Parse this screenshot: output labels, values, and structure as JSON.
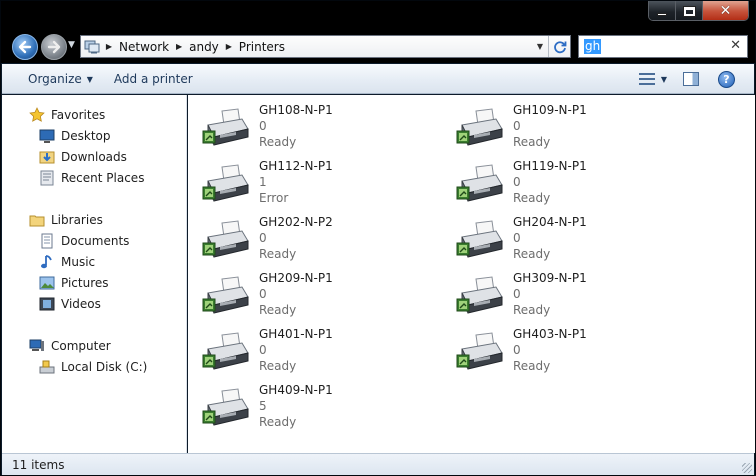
{
  "window": {
    "caption": {
      "minimize_icon": "minimize-icon",
      "maximize_icon": "maximize-icon",
      "close_icon": "close-icon",
      "close_glyph": "✕"
    }
  },
  "navigation": {
    "back_icon": "arrow-left-icon",
    "forward_icon": "arrow-right-icon",
    "breadcrumbs": [
      {
        "label": "Network"
      },
      {
        "label": "andy"
      },
      {
        "label": "Printers"
      }
    ]
  },
  "search": {
    "value": "gh",
    "clear_glyph": "✕"
  },
  "commandbar": {
    "organize": "Organize",
    "add_printer": "Add a printer"
  },
  "sidebar": {
    "groups": [
      {
        "label": "Favorites",
        "icon": "star-icon",
        "items": [
          {
            "label": "Desktop",
            "icon": "desktop-icon"
          },
          {
            "label": "Downloads",
            "icon": "downloads-icon"
          },
          {
            "label": "Recent Places",
            "icon": "recent-places-icon"
          }
        ]
      },
      {
        "label": "Libraries",
        "icon": "libraries-icon",
        "items": [
          {
            "label": "Documents",
            "icon": "documents-icon"
          },
          {
            "label": "Music",
            "icon": "music-icon"
          },
          {
            "label": "Pictures",
            "icon": "pictures-icon"
          },
          {
            "label": "Videos",
            "icon": "videos-icon"
          }
        ]
      },
      {
        "label": "Computer",
        "icon": "computer-icon",
        "items": [
          {
            "label": "Local Disk (C:)",
            "icon": "local-disk-icon"
          }
        ]
      }
    ]
  },
  "printers": [
    {
      "name": "GH108-N-P1",
      "jobs": "0",
      "status": "Ready"
    },
    {
      "name": "GH109-N-P1",
      "jobs": "0",
      "status": "Ready"
    },
    {
      "name": "GH112-N-P1",
      "jobs": "1",
      "status": "Error"
    },
    {
      "name": "GH119-N-P1",
      "jobs": "0",
      "status": "Ready"
    },
    {
      "name": "GH202-N-P2",
      "jobs": "0",
      "status": "Ready"
    },
    {
      "name": "GH204-N-P1",
      "jobs": "0",
      "status": "Ready"
    },
    {
      "name": "GH209-N-P1",
      "jobs": "0",
      "status": "Ready"
    },
    {
      "name": "GH309-N-P1",
      "jobs": "0",
      "status": "Ready"
    },
    {
      "name": "GH401-N-P1",
      "jobs": "0",
      "status": "Ready"
    },
    {
      "name": "GH403-N-P1",
      "jobs": "0",
      "status": "Ready"
    },
    {
      "name": "GH409-N-P1",
      "jobs": "5",
      "status": "Ready"
    }
  ],
  "statusbar": {
    "count": "11 items"
  }
}
